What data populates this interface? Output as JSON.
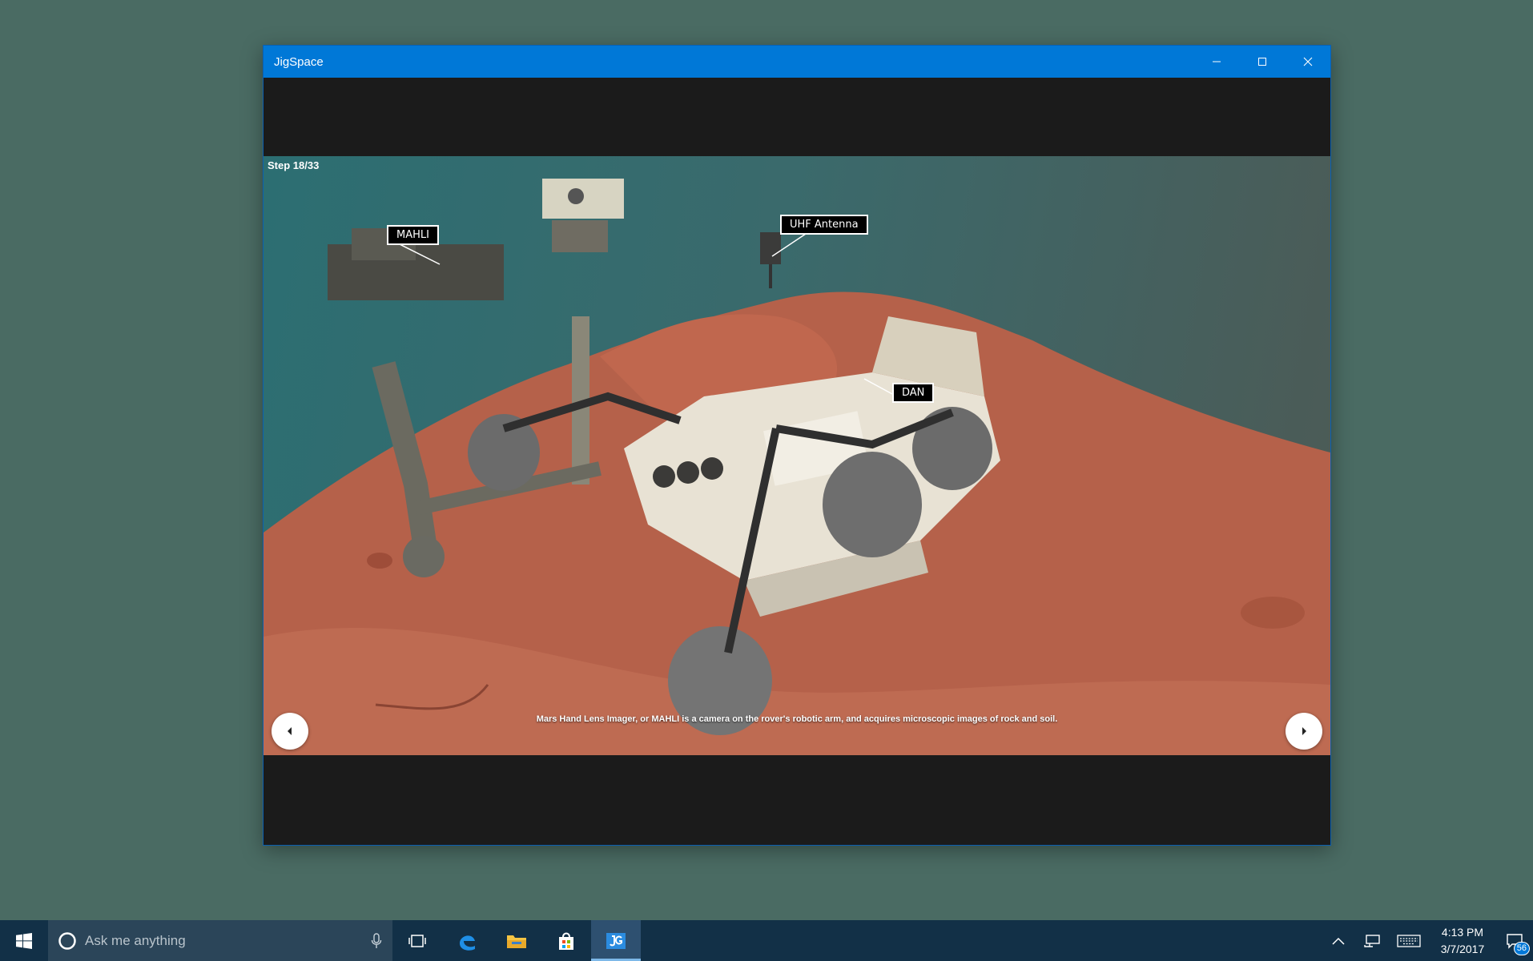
{
  "window": {
    "title": "JigSpace"
  },
  "viewer": {
    "step": "Step 18/33",
    "callouts": {
      "mahli": "MAHLI",
      "uhf": "UHF Antenna",
      "dan": "DAN"
    },
    "caption": "Mars Hand Lens Imager, or MAHLI is a camera on the rover's robotic arm, and acquires microscopic images of rock and soil."
  },
  "taskbar": {
    "search_placeholder": "Ask me anything",
    "icons": [
      "windows-start-icon",
      "cortana-icon",
      "microphone-icon",
      "task-view-icon",
      "edge-icon",
      "file-explorer-icon",
      "store-icon",
      "jigspace-icon"
    ],
    "clock_time": "4:13 PM",
    "clock_date": "3/7/2017",
    "notification_count": "56"
  },
  "colors": {
    "titlebar": "#0078d7",
    "desktop": "#4a6b63",
    "taskbar": "#123047",
    "terrain": "#b5614a"
  }
}
